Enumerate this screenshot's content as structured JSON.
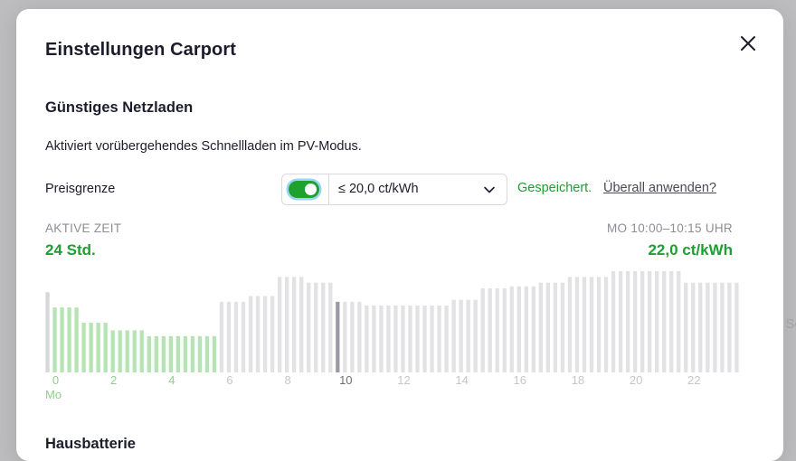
{
  "background": {
    "peek_text": "Sc"
  },
  "modal": {
    "title": "Einstellungen Carport",
    "close_icon": "close-icon",
    "section_grid": {
      "title": "Günstiges Netzladen",
      "description": "Aktiviert vorübergehendes Schnellladen im PV-Modus.",
      "price_limit": {
        "label": "Preisgrenze",
        "toggle_on": true,
        "selected": "≤ 20,0 ct/kWh",
        "status": "Gespeichert.",
        "apply_all": "Überall anwenden?"
      },
      "active_time": {
        "label": "AKTIVE ZEIT",
        "value": "24 Std."
      },
      "selected_slot": {
        "label": "MO 10:00–10:15 UHR",
        "price": "22,0 ct/kWh"
      }
    },
    "section_battery": {
      "title": "Hausbatterie"
    }
  },
  "chart_data": {
    "type": "bar",
    "description_axis": "15-minute price slots, hours 0–23",
    "x_ticks": [
      "0",
      "2",
      "4",
      "6",
      "8",
      "10",
      "12",
      "14",
      "16",
      "18",
      "20",
      "22"
    ],
    "x_day_label": "Mo",
    "selected_index": 40,
    "threshold": 20.0,
    "values": [
      21.0,
      17.0,
      17.0,
      17.0,
      17.0,
      13.0,
      13.0,
      13.0,
      13.0,
      11.0,
      11.0,
      11.0,
      11.0,
      11.0,
      9.5,
      9.5,
      9.5,
      9.5,
      9.5,
      9.5,
      9.5,
      9.5,
      9.5,
      9.5,
      18.5,
      18.5,
      18.5,
      18.5,
      20.0,
      20.0,
      20.0,
      20.0,
      25.0,
      25.0,
      25.0,
      25.0,
      23.5,
      23.5,
      23.5,
      23.5,
      18.5,
      18.5,
      18.5,
      18.5,
      17.5,
      17.5,
      17.5,
      17.5,
      17.5,
      17.5,
      17.5,
      17.5,
      17.5,
      17.5,
      17.5,
      17.5,
      19.0,
      19.0,
      19.0,
      19.0,
      22.0,
      22.0,
      22.0,
      22.0,
      22.5,
      22.5,
      22.5,
      22.5,
      23.5,
      23.5,
      23.5,
      23.5,
      25.0,
      25.0,
      25.0,
      25.0,
      25.0,
      25.0,
      26.5,
      26.5,
      26.5,
      26.5,
      26.5,
      26.5,
      26.5,
      26.5,
      26.5,
      26.5,
      23.5,
      23.5,
      23.5,
      23.5,
      23.5,
      23.5,
      23.5,
      23.5
    ],
    "colors": {
      "below": "#b6e3b3",
      "above": "#e2e2e4",
      "selected": "#9a9aa2",
      "first": "#d7d7da"
    }
  }
}
